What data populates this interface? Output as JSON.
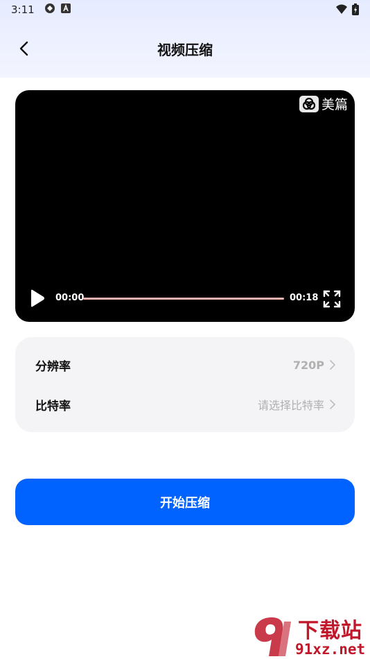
{
  "status_bar": {
    "time": "3:11"
  },
  "header": {
    "title": "视频压缩"
  },
  "video": {
    "watermark_text": "美篇",
    "current_time": "00:00",
    "total_time": "00:18",
    "progress": 0.0
  },
  "settings": {
    "resolution": {
      "label": "分辨率",
      "value": "720P"
    },
    "bitrate": {
      "label": "比特率",
      "value": "请选择比特率"
    }
  },
  "actions": {
    "start_label": "开始压缩"
  },
  "site_watermark": {
    "line1": "下载站",
    "line2": "91xz.net"
  },
  "colors": {
    "accent": "#0062ff",
    "progress_track": "#f2b2b2",
    "card_bg": "#f4f4f6",
    "watermark_red": "#c0182a"
  }
}
